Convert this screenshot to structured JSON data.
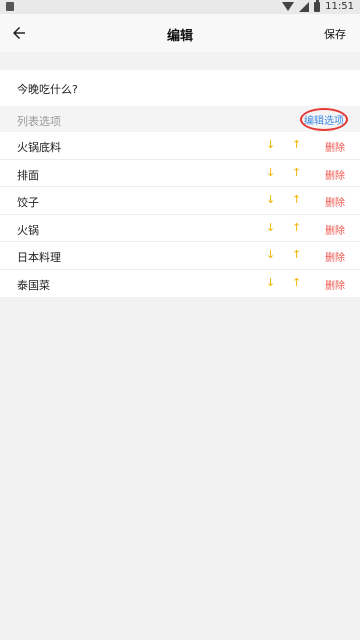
{
  "status_bar": {
    "time": "11:51"
  },
  "app_bar": {
    "title": "编辑",
    "save_label": "保存"
  },
  "question": {
    "text": "今晚吃什么?"
  },
  "list_header": {
    "label": "列表选项",
    "edit_label": "编辑选项"
  },
  "items": [
    {
      "label": "火锅底料",
      "delete_label": "删除"
    },
    {
      "label": "排面",
      "delete_label": "删除"
    },
    {
      "label": "饺子",
      "delete_label": "删除"
    },
    {
      "label": "火锅",
      "delete_label": "删除"
    },
    {
      "label": "日本料理",
      "delete_label": "删除"
    },
    {
      "label": "泰国菜",
      "delete_label": "删除"
    }
  ],
  "icons": {
    "move_down": "arrow-down-icon",
    "move_up": "arrow-up-icon",
    "back": "arrow-left-icon"
  },
  "colors": {
    "accent_yellow": "#f3b500",
    "delete_red": "#f0564b",
    "link_blue": "#3d8ae6",
    "highlight_red": "#e53935"
  }
}
